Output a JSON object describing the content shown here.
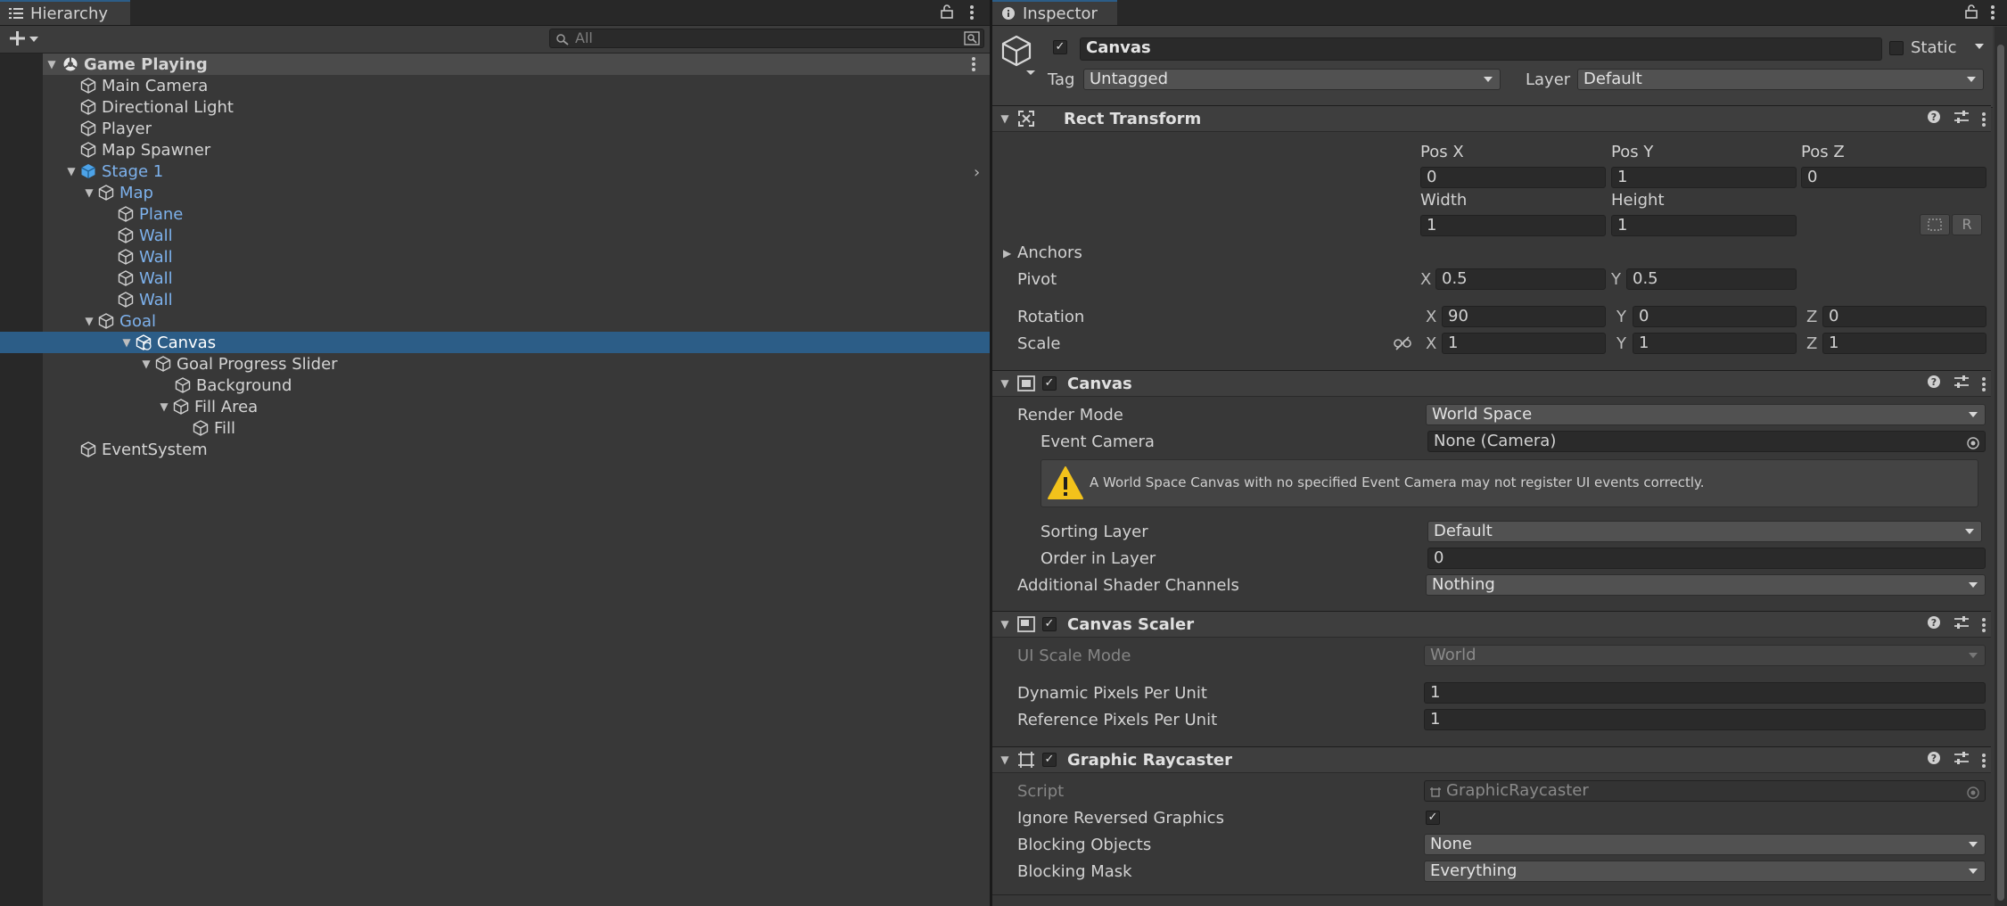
{
  "colors": {
    "selection": "#2c5d87",
    "prefab_text": "#7db1ec",
    "warning": "#f2c21b"
  },
  "hierarchy": {
    "tab_label": "Hierarchy",
    "search_placeholder": "All",
    "scene": "Game Playing",
    "items": [
      {
        "label": "Main Camera"
      },
      {
        "label": "Directional Light"
      },
      {
        "label": "Player"
      },
      {
        "label": "Map Spawner"
      },
      {
        "label": "Stage 1"
      },
      {
        "label": "Map"
      },
      {
        "label": "Plane"
      },
      {
        "label": "Wall"
      },
      {
        "label": "Wall"
      },
      {
        "label": "Wall"
      },
      {
        "label": "Wall"
      },
      {
        "label": "Goal"
      },
      {
        "label": "Canvas"
      },
      {
        "label": "Goal Progress Slider"
      },
      {
        "label": "Background"
      },
      {
        "label": "Fill Area"
      },
      {
        "label": "Fill"
      },
      {
        "label": "EventSystem"
      }
    ]
  },
  "inspector": {
    "tab_label": "Inspector",
    "object": {
      "name": "Canvas",
      "static_label": "Static",
      "tag_label": "Tag",
      "tag_value": "Untagged",
      "layer_label": "Layer",
      "layer_value": "Default"
    },
    "rect_transform": {
      "title": "Rect Transform",
      "pos_x_label": "Pos X",
      "pos_y_label": "Pos Y",
      "pos_z_label": "Pos Z",
      "pos_x": "0",
      "pos_y": "1",
      "pos_z": "0",
      "width_label": "Width",
      "height_label": "Height",
      "width": "1",
      "height": "1",
      "raw_label": "R",
      "anchors_label": "Anchors",
      "pivot_label": "Pivot",
      "pivot_x": "0.5",
      "pivot_y": "0.5",
      "rotation_label": "Rotation",
      "rot_x": "90",
      "rot_y": "0",
      "rot_z": "0",
      "scale_label": "Scale",
      "scale_x": "1",
      "scale_y": "1",
      "scale_z": "1",
      "x": "X",
      "y": "Y",
      "z": "Z"
    },
    "canvas": {
      "title": "Canvas",
      "render_mode_label": "Render Mode",
      "render_mode": "World Space",
      "event_camera_label": "Event Camera",
      "event_camera": "None (Camera)",
      "warning": "A World Space Canvas with no specified Event Camera may not register UI events correctly.",
      "sorting_layer_label": "Sorting Layer",
      "sorting_layer": "Default",
      "order_label": "Order in Layer",
      "order": "0",
      "shader_label": "Additional Shader Channels",
      "shader": "Nothing"
    },
    "canvas_scaler": {
      "title": "Canvas Scaler",
      "ui_scale_label": "UI Scale Mode",
      "ui_scale": "World",
      "dynamic_label": "Dynamic Pixels Per Unit",
      "dynamic": "1",
      "reference_label": "Reference Pixels Per Unit",
      "reference": "1"
    },
    "graphic_raycaster": {
      "title": "Graphic Raycaster",
      "script_label": "Script",
      "script": "GraphicRaycaster",
      "ignore_label": "Ignore Reversed Graphics",
      "blocking_objects_label": "Blocking Objects",
      "blocking_objects": "None",
      "blocking_mask_label": "Blocking Mask",
      "blocking_mask": "Everything"
    }
  }
}
